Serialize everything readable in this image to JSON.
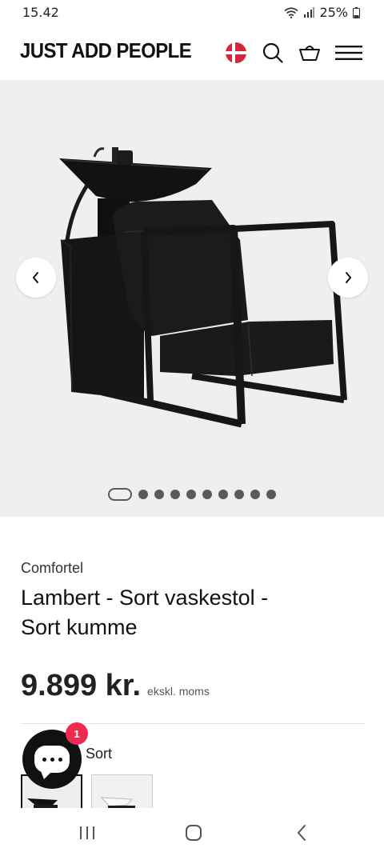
{
  "status": {
    "time": "15.42",
    "battery": "25%"
  },
  "header": {
    "logo": "JUST ADD PEOPLE",
    "icons": [
      "flag-denmark-icon",
      "search-icon",
      "basket-icon",
      "menu-icon"
    ]
  },
  "gallery": {
    "slide_count": 10,
    "active_slide": 1
  },
  "product": {
    "brand": "Comfortel",
    "title_line1": "Lambert - Sort vaskestol -",
    "title_line2": "Sort kumme",
    "price": "9.899 kr.",
    "price_note": "ekskl. moms"
  },
  "variant": {
    "selected_name": "Sort",
    "options": [
      "black-basin",
      "white-basin"
    ]
  },
  "chat": {
    "badge_count": "1"
  },
  "colors": {
    "accent_badge": "#ee2a4f",
    "gallery_bg": "#efefef",
    "text": "#111111"
  }
}
